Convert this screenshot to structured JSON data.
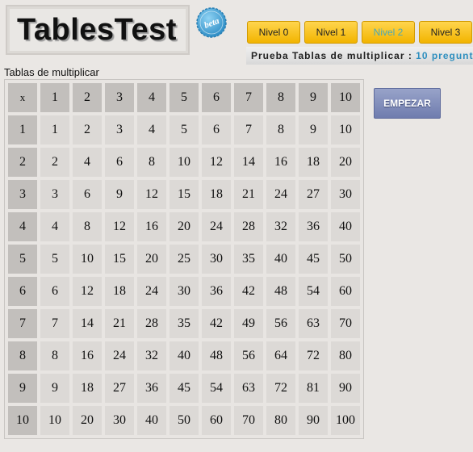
{
  "app": {
    "logo": "TablesTest",
    "beta": "beta"
  },
  "niveles": [
    "Nivel 0",
    "Nivel 1",
    "Nivel 2",
    "Nivel 3"
  ],
  "active_nivel": 2,
  "prueba": {
    "text": "Prueba Tablas de multiplicar : ",
    "link": "10 pregunt"
  },
  "section_title": "Tablas de multiplicar",
  "table": {
    "corner": "x",
    "headers": [
      "1",
      "2",
      "3",
      "4",
      "5",
      "6",
      "7",
      "8",
      "9",
      "10"
    ],
    "rows": [
      {
        "header": "1",
        "values": [
          "1",
          "2",
          "3",
          "4",
          "5",
          "6",
          "7",
          "8",
          "9",
          "10"
        ]
      },
      {
        "header": "2",
        "values": [
          "2",
          "4",
          "6",
          "8",
          "10",
          "12",
          "14",
          "16",
          "18",
          "20"
        ]
      },
      {
        "header": "3",
        "values": [
          "3",
          "6",
          "9",
          "12",
          "15",
          "18",
          "21",
          "24",
          "27",
          "30"
        ]
      },
      {
        "header": "4",
        "values": [
          "4",
          "8",
          "12",
          "16",
          "20",
          "24",
          "28",
          "32",
          "36",
          "40"
        ]
      },
      {
        "header": "5",
        "values": [
          "5",
          "10",
          "15",
          "20",
          "25",
          "30",
          "35",
          "40",
          "45",
          "50"
        ]
      },
      {
        "header": "6",
        "values": [
          "6",
          "12",
          "18",
          "24",
          "30",
          "36",
          "42",
          "48",
          "54",
          "60"
        ]
      },
      {
        "header": "7",
        "values": [
          "7",
          "14",
          "21",
          "28",
          "35",
          "42",
          "49",
          "56",
          "63",
          "70"
        ]
      },
      {
        "header": "8",
        "values": [
          "8",
          "16",
          "24",
          "32",
          "40",
          "48",
          "56",
          "64",
          "72",
          "80"
        ]
      },
      {
        "header": "9",
        "values": [
          "9",
          "18",
          "27",
          "36",
          "45",
          "54",
          "63",
          "72",
          "81",
          "90"
        ]
      },
      {
        "header": "10",
        "values": [
          "10",
          "20",
          "30",
          "40",
          "50",
          "60",
          "70",
          "80",
          "90",
          "100"
        ]
      }
    ]
  },
  "start_button": "EMPEZAR",
  "colors": {
    "nivel_bg": "#f2b400",
    "active_nivel_text": "#4aa8b7",
    "header_cell": "#c2bfbc",
    "value_cell": "#dcd9d6",
    "start_button": "#6f7cae"
  }
}
